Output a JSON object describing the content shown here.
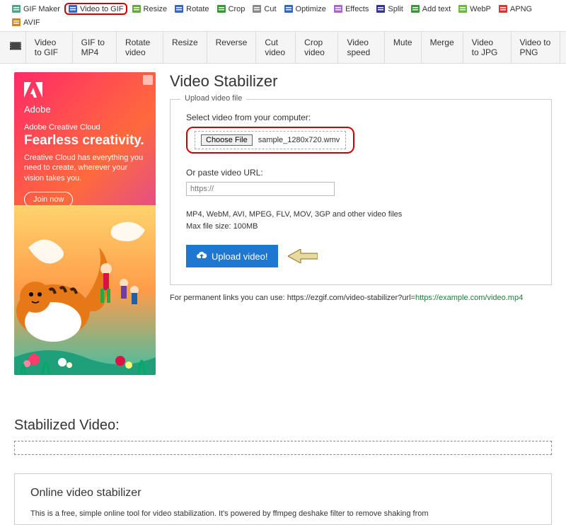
{
  "topnav": [
    {
      "label": "GIF Maker",
      "name": "nav-gif-maker",
      "hl": false
    },
    {
      "label": "Video to GIF",
      "name": "nav-video-to-gif",
      "hl": true
    },
    {
      "label": "Resize",
      "name": "nav-resize",
      "hl": false
    },
    {
      "label": "Rotate",
      "name": "nav-rotate",
      "hl": false
    },
    {
      "label": "Crop",
      "name": "nav-crop",
      "hl": false
    },
    {
      "label": "Cut",
      "name": "nav-cut",
      "hl": false
    },
    {
      "label": "Optimize",
      "name": "nav-optimize",
      "hl": false
    },
    {
      "label": "Effects",
      "name": "nav-effects",
      "hl": false
    },
    {
      "label": "Split",
      "name": "nav-split",
      "hl": false
    },
    {
      "label": "Add text",
      "name": "nav-add-text",
      "hl": false
    },
    {
      "label": "WebP",
      "name": "nav-webp",
      "hl": false
    },
    {
      "label": "APNG",
      "name": "nav-apng",
      "hl": false
    },
    {
      "label": "AVIF",
      "name": "nav-avif",
      "hl": false
    }
  ],
  "subnav": [
    "Video to GIF",
    "GIF to MP4",
    "Rotate video",
    "Resize",
    "Reverse",
    "Cut video",
    "Crop video",
    "Video speed",
    "Mute",
    "Merge",
    "Video to JPG",
    "Video to PNG"
  ],
  "ad": {
    "brand": "Adobe",
    "line1": "Adobe Creative Cloud",
    "line2": "Fearless creativity.",
    "body": "Creative Cloud has everything you need to create, wherever your vision takes you.",
    "cta": "Join now"
  },
  "page": {
    "title": "Video Stabilizer",
    "legend": "Upload video file",
    "select_label": "Select video from your computer:",
    "choose_btn": "Choose File",
    "filename": "sample_1280x720.wmv",
    "url_label": "Or paste video URL:",
    "url_placeholder": "https://",
    "formats": "MP4, WebM, AVI, MPEG, FLV, MOV, 3GP and other video files",
    "maxsize": "Max file size: 100MB",
    "upload_btn": "Upload video!",
    "permalink_prefix": "For permanent links you can use: https://ezgif.com/video-stabilizer?url=",
    "permalink_url": "https://example.com/video.mp4",
    "h2": "Stabilized Video:",
    "info_title": "Online video stabilizer",
    "info_body": "This is a free, simple online tool for video stabilization. It's powered by ffmpeg deshake filter to remove shaking from"
  },
  "icon_colors": {
    "gif_maker": "#4a8",
    "video_to_gif": "#36c",
    "resize": "#6a3",
    "rotate": "#36c",
    "crop": "#393",
    "cut": "#888",
    "optimize": "#36c",
    "effects": "#a6c",
    "split": "#339",
    "add_text": "#393",
    "webp": "#6b3",
    "apng": "#d33",
    "avif": "#c82"
  }
}
